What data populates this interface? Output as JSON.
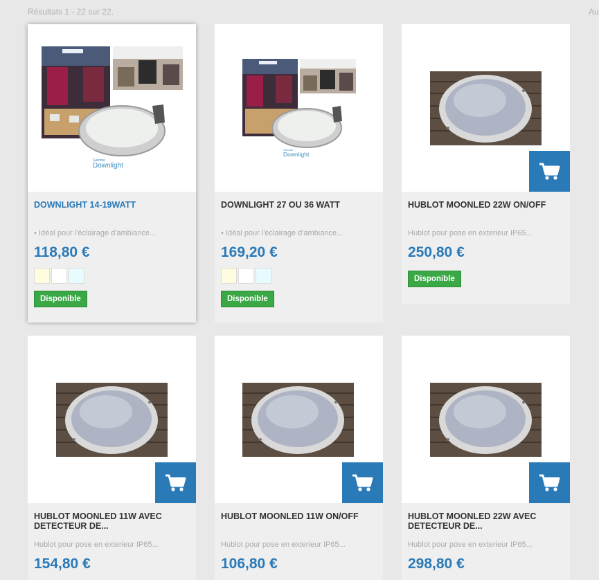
{
  "results_text": "Résultats 1 - 22 sur 22.",
  "top_right_text": "Au",
  "products": [
    {
      "name": "DOWNLIGHT 14-19WATT",
      "description": "• Idéal pour l'éclairage d'ambiance...",
      "price": "118,80 €",
      "availability": "Disponible",
      "image_caption_small": "Gamme",
      "image_caption": "Downlight",
      "swatches": [
        "#fffde0",
        "#ffffff",
        "#e8fbff"
      ],
      "has_cart_button": false
    },
    {
      "name": "DOWNLIGHT 27 OU 36 WATT",
      "description": "• Idéal pour l'éclairage d'ambiance...",
      "price": "169,20 €",
      "availability": "Disponible",
      "image_caption_small": "Gamme",
      "image_caption": "Downlight",
      "swatches": [
        "#fffde0",
        "#ffffff",
        "#e8fbff"
      ],
      "has_cart_button": false
    },
    {
      "name": "HUBLOT MOONLED 22W ON/OFF",
      "description": "Hublot pour pose en exterieur IP65...",
      "price": "250,80 €",
      "availability": "Disponible",
      "has_cart_button": true
    },
    {
      "name": "HUBLOT MOONLED 11W AVEC DETECTEUR DE...",
      "description": "Hublot pour pose en exterieur IP65...",
      "price": "154,80 €",
      "has_cart_button": true
    },
    {
      "name": "HUBLOT MOONLED 11W ON/OFF",
      "description": "Hublot pour pose en exterieur IP65...",
      "price": "106,80 €",
      "has_cart_button": true
    },
    {
      "name": "HUBLOT MOONLED 22W AVEC DETECTEUR DE...",
      "description": "Hublot pour pose en exterieur IP65...",
      "price": "298,80 €",
      "has_cart_button": true
    }
  ],
  "colors": {
    "accent_blue": "#2a7ab8",
    "available_green": "#3aa845",
    "card_bg": "#efefef",
    "page_bg": "#e8e8e8"
  },
  "icons": {
    "cart": "shopping-cart-icon"
  }
}
